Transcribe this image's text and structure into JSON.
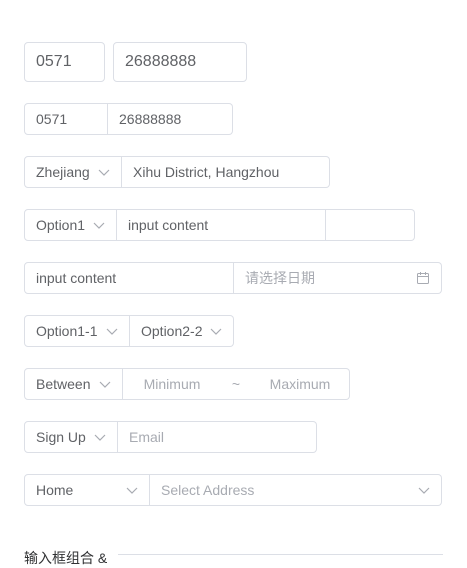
{
  "phone_large": {
    "area": "0571",
    "number": "26888888"
  },
  "phone_small": {
    "area": "0571",
    "number": "26888888"
  },
  "address": {
    "province": "Zhejiang",
    "detail": "Xihu District, Hangzhou"
  },
  "option_row": {
    "select": "Option1",
    "input": "input content",
    "extra": ""
  },
  "date_row": {
    "input": "input content",
    "date_placeholder": "请选择日期"
  },
  "cascade": {
    "first": "Option1-1",
    "second": "Option2-2"
  },
  "range": {
    "mode": "Between",
    "min_placeholder": "Minimum",
    "sep": "~",
    "max_placeholder": "Maximum"
  },
  "signup": {
    "select": "Sign Up",
    "email_placeholder": "Email"
  },
  "location": {
    "select": "Home",
    "address_placeholder": "Select Address"
  },
  "footer_label": "输入框组合 &"
}
